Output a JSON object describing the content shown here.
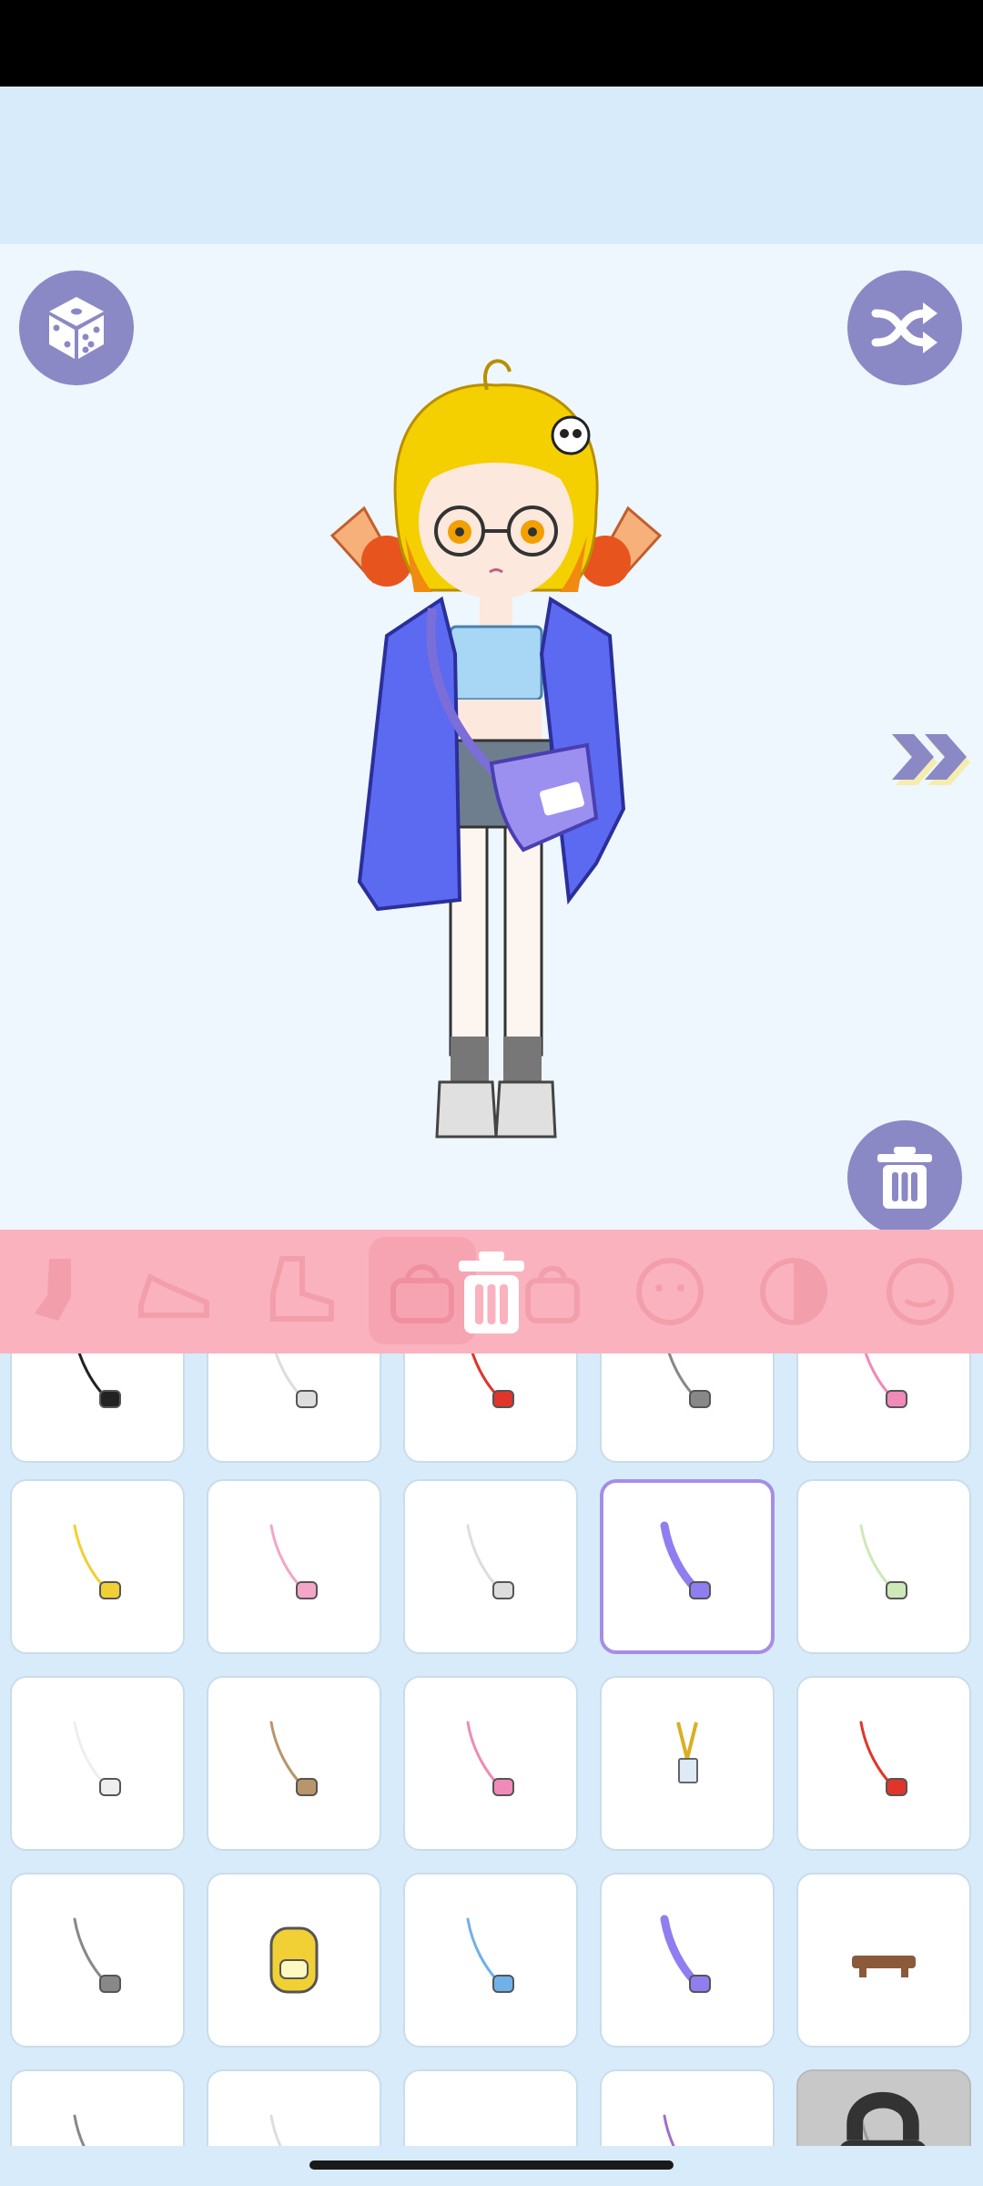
{
  "app": {
    "buttons": {
      "random_dice": "dice-icon",
      "shuffle": "shuffle-icon",
      "next_panel": "double-chevron-right-icon",
      "clear_outfit": "trash-icon"
    },
    "categories": [
      {
        "name": "socks",
        "icon": "sock-icon"
      },
      {
        "name": "shoes",
        "icon": "shoe-icon"
      },
      {
        "name": "boots",
        "icon": "boot-icon"
      },
      {
        "name": "bags",
        "icon": "bag-icon",
        "selected": true
      },
      {
        "name": "bag-alt",
        "icon": "bag-icon"
      },
      {
        "name": "face",
        "icon": "face-icon"
      },
      {
        "name": "makeup",
        "icon": "half-circle-icon"
      },
      {
        "name": "expression",
        "icon": "face-icon"
      }
    ],
    "category_delete": "trash-icon",
    "colors": {
      "accent": "#8b88c6",
      "category_bar": "#fab3be",
      "selected_border": "#a48ee8",
      "background": "#d7ebfb"
    },
    "items_grid": {
      "columns": 5,
      "selected_index": 8,
      "items": [
        "bag-black",
        "bag-white",
        "bag-red",
        "bag-gray",
        "bag-pink",
        "bag-yellow",
        "bag-ribbon",
        "bag-white-pouch",
        "bag-purple",
        "bag-green",
        "bag-bunny",
        "bag-tan",
        "bag-pink-box",
        "lanyard-card",
        "bag-red-bow",
        "bag-gray-case",
        "backpack-yellow",
        "bag-blue",
        "bag-purple-purse",
        "belt-brown",
        "bag-gray-strap",
        "bag-white-strap",
        "bag-empty",
        "bag-violet",
        "bag-locked"
      ]
    }
  }
}
